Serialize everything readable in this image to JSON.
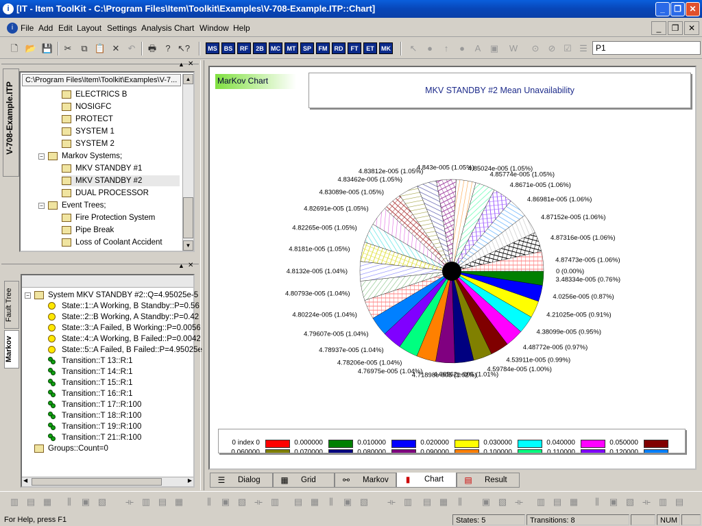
{
  "window": {
    "title": "[IT - Item ToolKit - C:\\Program Files\\Item\\Toolkit\\Examples\\V-708-Example.ITP::Chart]"
  },
  "menu": [
    "File",
    "Add",
    "Edit",
    "Layout",
    "Settings",
    "Analysis",
    "Chart",
    "Window",
    "Help"
  ],
  "toolbar": {
    "blocks": [
      "MS",
      "BS",
      "RF",
      "2B",
      "MC",
      "MT",
      "SP",
      "FM",
      "RD",
      "FT",
      "ET",
      "MK"
    ],
    "input_value": "P1"
  },
  "project_tab": "V-708-Example.ITP",
  "tree": {
    "path": "C:\\Program Files\\Item\\Toolkit\\Examples\\V-7...",
    "items": [
      "ELECTRICS B",
      "NOSIGFC",
      "PROTECT",
      "SYSTEM 1",
      "SYSTEM 2"
    ],
    "markov_header": "Markov Systems;",
    "markov_items": [
      "MKV STANDBY #1",
      "MKV STANDBY #2",
      "DUAL PROCESSOR"
    ],
    "event_header": "Event Trees;",
    "event_items": [
      "Fire Protection System",
      "Pipe Break",
      "Loss of Coolant Accident"
    ]
  },
  "markov_tree": {
    "root": "System MKV STANDBY #2::Q=4.95025e-5",
    "states": [
      "State::1::A Working, B Standby::P=0.56",
      "State::2::B Working, A Standby::P=0.42",
      "State::3::A Failed, B Working::P=0.0056",
      "State::4::A Working, B Failed::P=0.0042",
      "State::5::A Failed, B Failed::P=4.95025e"
    ],
    "transitions": [
      "Transition::T 13::R:1",
      "Transition::T 14::R:1",
      "Transition::T 15::R:1",
      "Transition::T 16::R:1",
      "Transition::T 17::R:100",
      "Transition::T 18::R:100",
      "Transition::T 19::R:100",
      "Transition::T 21::R:100"
    ],
    "groups": "Groups::Count=0"
  },
  "side_tabs": [
    "Fault Tree",
    "Markov"
  ],
  "chart_label": "MarKov Chart",
  "chart_data": {
    "type": "pie",
    "title": "MKV STANDBY #2 Mean Unavailability",
    "slices": [
      {
        "label": "0 (0.00%)",
        "value": 0
      },
      {
        "label": "3.48334e-005 (0.76%)",
        "value": 3.48334e-05
      },
      {
        "label": "4.0256e-005 (0.87%)",
        "value": 4.0256e-05
      },
      {
        "label": "4.21025e-005 (0.91%)",
        "value": 4.21025e-05
      },
      {
        "label": "4.38099e-005 (0.95%)",
        "value": 4.38099e-05
      },
      {
        "label": "4.48772e-005 (0.97%)",
        "value": 4.48772e-05
      },
      {
        "label": "4.53911e-005 (0.99%)",
        "value": 4.53911e-05
      },
      {
        "label": "4.59784e-005 (1.00%)",
        "value": 4.59784e-05
      },
      {
        "label": "4.66562e-005 (1.01%)",
        "value": 4.66562e-05
      },
      {
        "label": "4.71898e-005 (1.02%)",
        "value": 4.71898e-05
      },
      {
        "label": "4.76975e-005 (1.04%)",
        "value": 4.76975e-05
      },
      {
        "label": "4.78206e-005 (1.04%)",
        "value": 4.78206e-05
      },
      {
        "label": "4.78937e-005 (1.04%)",
        "value": 4.78937e-05
      },
      {
        "label": "4.79607e-005 (1.04%)",
        "value": 4.79607e-05
      },
      {
        "label": "4.80224e-005 (1.04%)",
        "value": 4.80224e-05
      },
      {
        "label": "4.80793e-005 (1.04%)",
        "value": 4.80793e-05
      },
      {
        "label": "4.8132e-005 (1.04%)",
        "value": 4.8132e-05
      },
      {
        "label": "4.8181e-005 (1.05%)",
        "value": 4.8181e-05
      },
      {
        "label": "4.82265e-005 (1.05%)",
        "value": 4.82265e-05
      },
      {
        "label": "4.82691e-005 (1.05%)",
        "value": 4.82691e-05
      },
      {
        "label": "4.83089e-005 (1.05%)",
        "value": 4.83089e-05
      },
      {
        "label": "4.83462e-005 (1.05%)",
        "value": 4.83462e-05
      },
      {
        "label": "4.83812e-005 (1.05%)",
        "value": 4.83812e-05
      },
      {
        "label": "4.843e-005 (1.05%)",
        "value": 4.843e-05
      },
      {
        "label": "4.85024e-005 (1.05%)",
        "value": 4.85024e-05
      },
      {
        "label": "4.85774e-005 (1.05%)",
        "value": 4.85774e-05
      },
      {
        "label": "4.8671e-005 (1.06%)",
        "value": 4.8671e-05
      },
      {
        "label": "4.86981e-005 (1.06%)",
        "value": 4.86981e-05
      },
      {
        "label": "4.87152e-005 (1.06%)",
        "value": 4.87152e-05
      },
      {
        "label": "4.87316e-005 (1.06%)",
        "value": 4.87316e-05
      },
      {
        "label": "4.87473e-005 (1.06%)",
        "value": 4.87473e-05
      }
    ],
    "legend": [
      {
        "label": "0 index 0",
        "color": "#ff0000"
      },
      {
        "label": "0.000000",
        "color": "#008000"
      },
      {
        "label": "0.010000",
        "color": "#0000ff"
      },
      {
        "label": "0.020000",
        "color": "#ffff00"
      },
      {
        "label": "0.030000",
        "color": "#00ffff"
      },
      {
        "label": "0.040000",
        "color": "#ff00ff"
      },
      {
        "label": "0.050000",
        "color": "#800000"
      },
      {
        "label": "0.060000",
        "color": "#808000"
      },
      {
        "label": "0.070000",
        "color": "#000080"
      },
      {
        "label": "0.080000",
        "color": "#800080"
      },
      {
        "label": "0.090000",
        "color": "#ff8000"
      },
      {
        "label": "0.100000",
        "color": "#00ff80"
      },
      {
        "label": "0.110000",
        "color": "#8000ff"
      },
      {
        "label": "0.120000",
        "color": "#0080ff"
      }
    ]
  },
  "bottom_tabs": [
    "Dialog",
    "Grid",
    "Markov",
    "Chart",
    "Result"
  ],
  "status": {
    "help": "For Help, press F1",
    "states": "States: 5",
    "transitions": "Transitions: 8",
    "num": "NUM"
  }
}
